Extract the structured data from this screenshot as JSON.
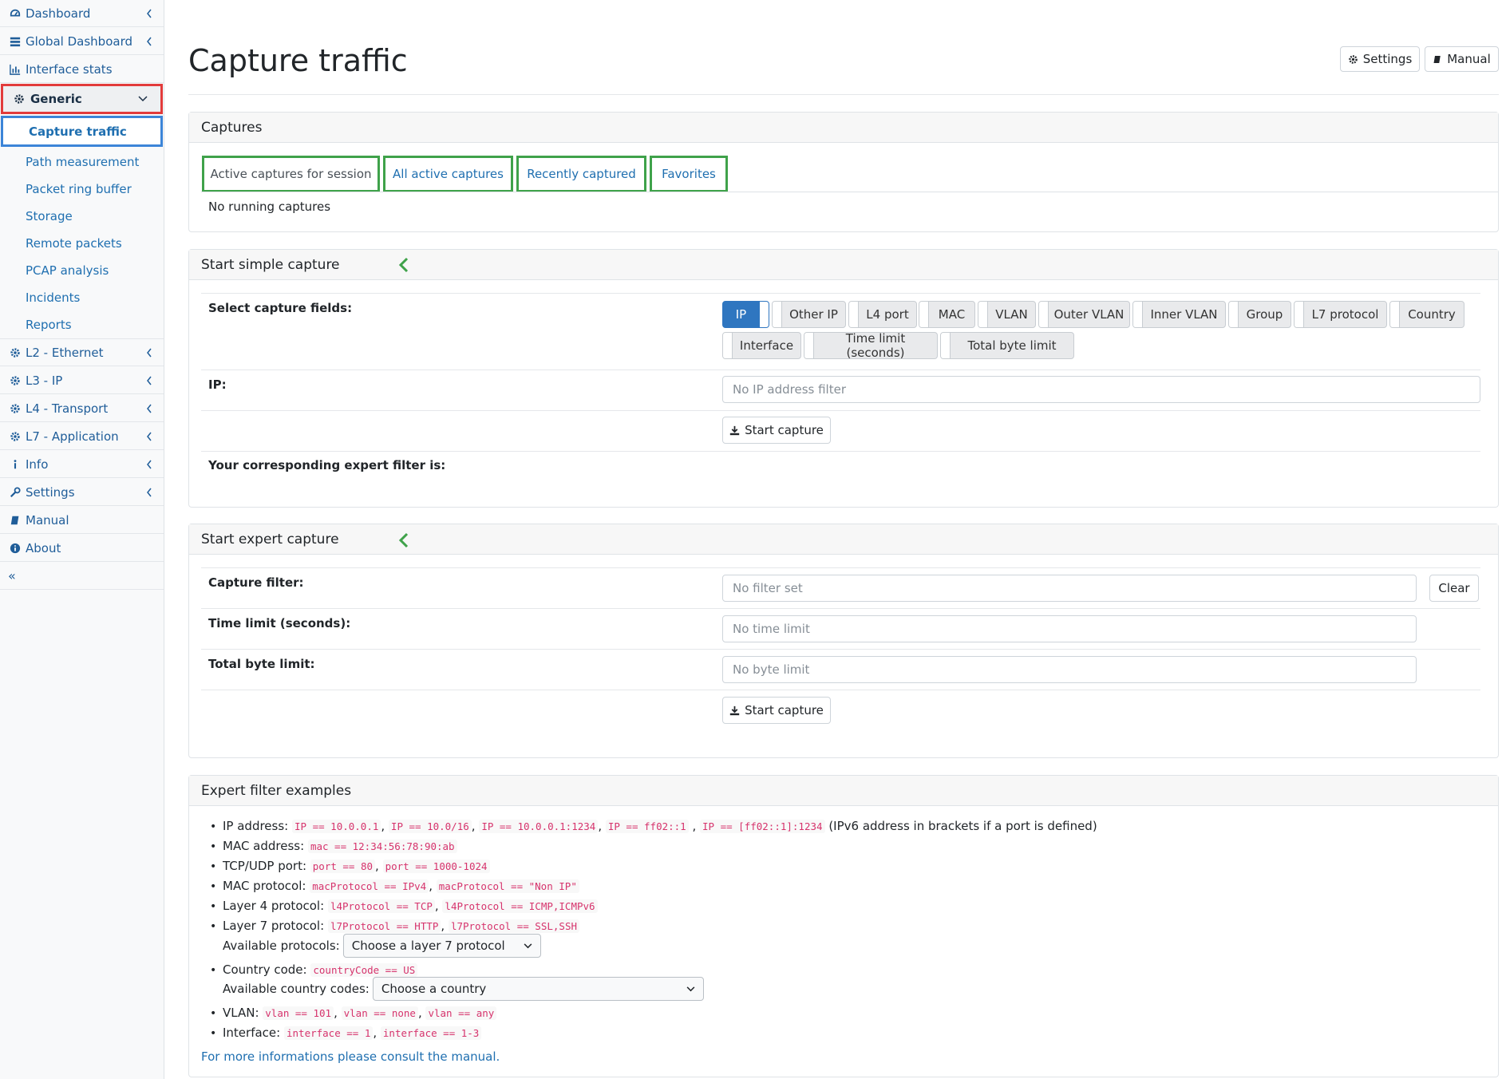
{
  "sidebar": {
    "top_items": [
      {
        "label": "Dashboard",
        "icon": "dashboard-icon",
        "has_chevron": true
      },
      {
        "label": "Global Dashboard",
        "icon": "server-icon",
        "has_chevron": true
      },
      {
        "label": "Interface stats",
        "icon": "bar-chart-icon",
        "has_chevron": false
      }
    ],
    "generic": {
      "label": "Generic",
      "icon": "gear-icon"
    },
    "sub_items": [
      {
        "label": "Capture traffic",
        "active": true
      },
      {
        "label": "Path measurement"
      },
      {
        "label": "Packet ring buffer"
      },
      {
        "label": "Storage"
      },
      {
        "label": "Remote packets"
      },
      {
        "label": "PCAP analysis"
      },
      {
        "label": "Incidents"
      },
      {
        "label": "Reports"
      }
    ],
    "bottom_items": [
      {
        "label": "L2 - Ethernet",
        "icon": "gear-icon",
        "has_chevron": true
      },
      {
        "label": "L3 - IP",
        "icon": "gear-icon",
        "has_chevron": true
      },
      {
        "label": "L4 - Transport",
        "icon": "gear-icon",
        "has_chevron": true
      },
      {
        "label": "L7 - Application",
        "icon": "gear-icon",
        "has_chevron": true
      },
      {
        "label": "Info",
        "icon": "info-icon",
        "has_chevron": true
      },
      {
        "label": "Settings",
        "icon": "wrench-icon",
        "has_chevron": true
      },
      {
        "label": "Manual",
        "icon": "book-icon",
        "has_chevron": false
      },
      {
        "label": "About",
        "icon": "info-circle-icon",
        "has_chevron": false
      }
    ],
    "collapse_label": "«"
  },
  "header": {
    "title": "Capture traffic",
    "settings_label": "Settings",
    "manual_label": "Manual"
  },
  "captures": {
    "title": "Captures",
    "tabs": [
      {
        "label": "Active captures for session",
        "active": true
      },
      {
        "label": "All active captures"
      },
      {
        "label": "Recently captured"
      },
      {
        "label": "Favorites"
      }
    ],
    "empty_text": "No running captures"
  },
  "simple": {
    "title": "Start simple capture",
    "fields_label": "Select capture fields:",
    "fields": [
      {
        "label": "IP",
        "on": true
      },
      {
        "label": "Other IP"
      },
      {
        "label": "L4 port"
      },
      {
        "label": "MAC"
      },
      {
        "label": "VLAN"
      },
      {
        "label": "Outer VLAN"
      },
      {
        "label": "Inner VLAN"
      },
      {
        "label": "Group"
      },
      {
        "label": "L7 protocol"
      },
      {
        "label": "Country"
      },
      {
        "label": "Interface"
      },
      {
        "label": "Time limit (seconds)"
      },
      {
        "label": "Total byte limit"
      }
    ],
    "ip_label": "IP:",
    "ip_placeholder": "No IP address filter",
    "start_label": "Start capture",
    "expert_filter_label": "Your corresponding expert filter is:"
  },
  "expert": {
    "title": "Start expert capture",
    "filter_label": "Capture filter:",
    "filter_placeholder": "No filter set",
    "clear_label": "Clear",
    "time_label": "Time limit (seconds):",
    "time_placeholder": "No time limit",
    "bytes_label": "Total byte limit:",
    "bytes_placeholder": "No byte limit",
    "start_label": "Start capture"
  },
  "examples": {
    "title": "Expert filter examples",
    "ip": {
      "label": "IP address:",
      "codes": [
        "IP == 10.0.0.1",
        "IP == 10.0/16",
        "IP == 10.0.0.1:1234",
        "IP == ff02::1",
        "IP == [ff02::1]:1234"
      ],
      "note": "(IPv6 address in brackets if a port is defined)"
    },
    "mac": {
      "label": "MAC address:",
      "codes": [
        "mac == 12:34:56:78:90:ab"
      ]
    },
    "port": {
      "label": "TCP/UDP port:",
      "codes": [
        "port == 80",
        "port == 1000-1024"
      ]
    },
    "macproto": {
      "label": "MAC protocol:",
      "codes": [
        "macProtocol == IPv4",
        "macProtocol == \"Non IP\""
      ]
    },
    "l4": {
      "label": "Layer 4 protocol:",
      "codes": [
        "l4Protocol == TCP",
        "l4Protocol == ICMP,ICMPv6"
      ]
    },
    "l7": {
      "label": "Layer 7 protocol:",
      "codes": [
        "l7Protocol == HTTP",
        "l7Protocol == SSL,SSH"
      ]
    },
    "protocols_label": "Available protocols:",
    "protocols_select": "Choose a layer 7 protocol",
    "country": {
      "label": "Country code:",
      "codes": [
        "countryCode == US"
      ]
    },
    "countries_label": "Available country codes:",
    "countries_select": "Choose a country",
    "vlan": {
      "label": "VLAN:",
      "codes": [
        "vlan == 101",
        "vlan == none",
        "vlan == any"
      ]
    },
    "iface": {
      "label": "Interface:",
      "codes": [
        "interface == 1",
        "interface == 1-3"
      ]
    },
    "manual_link": "For more informations please consult the manual."
  },
  "colors": {
    "accent": "#2f76c0",
    "link": "#1f6fb0",
    "tab_outline": "#3fa24a",
    "generic_outline": "#e23b3b",
    "active_outline": "#3c85d8",
    "code": "#d6336c"
  }
}
